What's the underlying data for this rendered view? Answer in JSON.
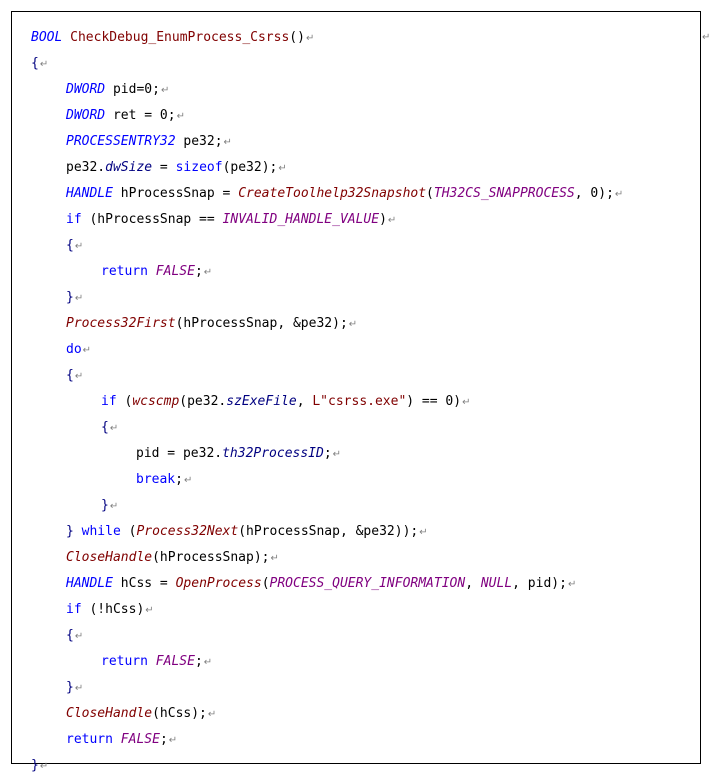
{
  "paragraph_mark": "↵",
  "code_lines": [
    {
      "indent": 0,
      "tokens": [
        {
          "t": "BOOL",
          "c": "t"
        },
        {
          "t": " ",
          "c": "x"
        },
        {
          "t": "CheckDebug_EnumProcess_Csrss",
          "c": "s"
        },
        {
          "t": "()",
          "c": "p"
        }
      ]
    },
    {
      "indent": 0,
      "tokens": [
        {
          "t": "{",
          "c": "br"
        }
      ]
    },
    {
      "indent": 1,
      "tokens": [
        {
          "t": "DWORD",
          "c": "t"
        },
        {
          "t": " pid=0;",
          "c": "x"
        }
      ]
    },
    {
      "indent": 1,
      "tokens": [
        {
          "t": "DWORD",
          "c": "t"
        },
        {
          "t": " ret = 0;",
          "c": "x"
        }
      ]
    },
    {
      "indent": 1,
      "tokens": [
        {
          "t": "PROCESSENTRY32",
          "c": "t"
        },
        {
          "t": " pe32;",
          "c": "x"
        }
      ]
    },
    {
      "indent": 1,
      "tokens": [
        {
          "t": "pe32.",
          "c": "x"
        },
        {
          "t": "dwSize",
          "c": "m"
        },
        {
          "t": " = ",
          "c": "x"
        },
        {
          "t": "sizeof",
          "c": "k"
        },
        {
          "t": "(pe32);",
          "c": "x"
        }
      ]
    },
    {
      "indent": 1,
      "tokens": [
        {
          "t": "HANDLE",
          "c": "t"
        },
        {
          "t": " hProcessSnap = ",
          "c": "x"
        },
        {
          "t": "CreateToolhelp32Snapshot",
          "c": "f"
        },
        {
          "t": "(",
          "c": "x"
        },
        {
          "t": "TH32CS_SNAPPROCESS",
          "c": "c"
        },
        {
          "t": ", 0);",
          "c": "x"
        }
      ]
    },
    {
      "indent": 1,
      "tokens": [
        {
          "t": "if",
          "c": "k"
        },
        {
          "t": " (hProcessSnap == ",
          "c": "x"
        },
        {
          "t": "INVALID_HANDLE_VALUE",
          "c": "c"
        },
        {
          "t": ")",
          "c": "x"
        }
      ]
    },
    {
      "indent": 1,
      "tokens": [
        {
          "t": "{",
          "c": "br"
        }
      ]
    },
    {
      "indent": 2,
      "tokens": [
        {
          "t": "return",
          "c": "k"
        },
        {
          "t": " ",
          "c": "x"
        },
        {
          "t": "FALSE",
          "c": "c"
        },
        {
          "t": ";",
          "c": "x"
        }
      ]
    },
    {
      "indent": 1,
      "tokens": [
        {
          "t": "}",
          "c": "br"
        }
      ]
    },
    {
      "indent": 1,
      "tokens": [
        {
          "t": "Process32First",
          "c": "f"
        },
        {
          "t": "(hProcessSnap, &pe32);",
          "c": "x"
        }
      ]
    },
    {
      "indent": 1,
      "tokens": [
        {
          "t": "do",
          "c": "k"
        }
      ]
    },
    {
      "indent": 1,
      "tokens": [
        {
          "t": "{",
          "c": "br"
        }
      ]
    },
    {
      "indent": 2,
      "tokens": [
        {
          "t": "if",
          "c": "k"
        },
        {
          "t": " (",
          "c": "x"
        },
        {
          "t": "wcscmp",
          "c": "f"
        },
        {
          "t": "(pe32.",
          "c": "x"
        },
        {
          "t": "szExeFile",
          "c": "m"
        },
        {
          "t": ", ",
          "c": "x"
        },
        {
          "t": "L\"csrss.exe\"",
          "c": "s"
        },
        {
          "t": ") == 0)",
          "c": "x"
        }
      ]
    },
    {
      "indent": 2,
      "tokens": [
        {
          "t": "{",
          "c": "br"
        }
      ]
    },
    {
      "indent": 3,
      "tokens": [
        {
          "t": "pid = pe32.",
          "c": "x"
        },
        {
          "t": "th32ProcessID",
          "c": "m"
        },
        {
          "t": ";",
          "c": "x"
        }
      ]
    },
    {
      "indent": 3,
      "tokens": [
        {
          "t": "break",
          "c": "k"
        },
        {
          "t": ";",
          "c": "x"
        }
      ]
    },
    {
      "indent": 2,
      "tokens": [
        {
          "t": "}",
          "c": "br"
        }
      ]
    },
    {
      "indent": 1,
      "tokens": [
        {
          "t": "}",
          "c": "br"
        },
        {
          "t": " ",
          "c": "x"
        },
        {
          "t": "while",
          "c": "k"
        },
        {
          "t": " (",
          "c": "x"
        },
        {
          "t": "Process32Next",
          "c": "f"
        },
        {
          "t": "(hProcessSnap, &pe32));",
          "c": "x"
        }
      ]
    },
    {
      "indent": 1,
      "tokens": [
        {
          "t": "CloseHandle",
          "c": "f"
        },
        {
          "t": "(hProcessSnap);",
          "c": "x"
        }
      ]
    },
    {
      "indent": 1,
      "tokens": [
        {
          "t": "HANDLE",
          "c": "t"
        },
        {
          "t": " hCss = ",
          "c": "x"
        },
        {
          "t": "OpenProcess",
          "c": "f"
        },
        {
          "t": "(",
          "c": "x"
        },
        {
          "t": "PROCESS_QUERY_INFORMATION",
          "c": "c"
        },
        {
          "t": ", ",
          "c": "x"
        },
        {
          "t": "NULL",
          "c": "c"
        },
        {
          "t": ", pid);",
          "c": "x"
        }
      ]
    },
    {
      "indent": 1,
      "tokens": [
        {
          "t": "if",
          "c": "k"
        },
        {
          "t": " (!hCss)",
          "c": "x"
        }
      ]
    },
    {
      "indent": 1,
      "tokens": [
        {
          "t": "{",
          "c": "br"
        }
      ]
    },
    {
      "indent": 2,
      "tokens": [
        {
          "t": "return",
          "c": "k"
        },
        {
          "t": " ",
          "c": "x"
        },
        {
          "t": "FALSE",
          "c": "c"
        },
        {
          "t": ";",
          "c": "x"
        }
      ]
    },
    {
      "indent": 1,
      "tokens": [
        {
          "t": "}",
          "c": "br"
        }
      ]
    },
    {
      "indent": 1,
      "tokens": [
        {
          "t": "CloseHandle",
          "c": "f"
        },
        {
          "t": "(hCss);",
          "c": "x"
        }
      ]
    },
    {
      "indent": 1,
      "tokens": [
        {
          "t": "return",
          "c": "k"
        },
        {
          "t": " ",
          "c": "x"
        },
        {
          "t": "FALSE",
          "c": "c"
        },
        {
          "t": ";",
          "c": "x"
        }
      ]
    },
    {
      "indent": 0,
      "tokens": [
        {
          "t": "}",
          "c": "br"
        }
      ]
    }
  ]
}
